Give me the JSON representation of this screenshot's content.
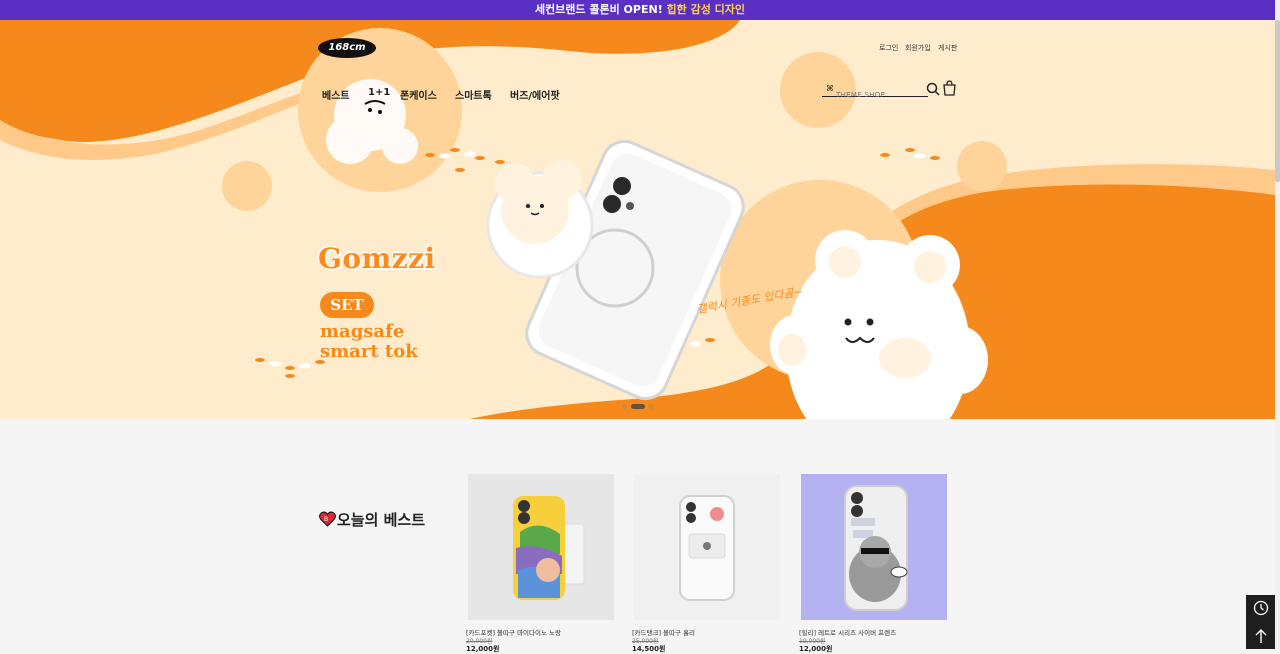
{
  "topbar": {
    "text_a": "세컨브랜드 콜론비 OPEN! ",
    "text_b": "힙한 감성 디자인"
  },
  "header": {
    "logo_text": "168cm",
    "util_links": [
      "로그인",
      "회원가입",
      "게시판"
    ],
    "nav": [
      "베스트",
      "1+1",
      "폰케이스",
      "스마트톡",
      "버즈/에어팟"
    ],
    "search": {
      "placeholder": "THEME SHOP",
      "icon": "search-icon"
    },
    "cart_icon": "bag-icon"
  },
  "hero": {
    "brand": "Gomzzi",
    "pill": "SET",
    "line1": "magsafe",
    "line2": "smart tok",
    "handwriting": "갤럭시 기종도 있다곰~",
    "slides": 3,
    "active_slide": 2,
    "colors": {
      "orange": "#f5891c",
      "cream": "#ffeccd",
      "deep": "#ff8a1c"
    }
  },
  "best": {
    "title": "오늘의 베스트",
    "products": [
      {
        "name": "[카드포켓] 볼따구 마이다이노 노랑",
        "original_price": "20,000원",
        "price": "12,000원",
        "bg": "#e6e6e6"
      },
      {
        "name": "[카드탱크] 볼따구 홀리",
        "original_price": "25,000원",
        "price": "14,500원",
        "bg": "#f0f0f0"
      },
      {
        "name": "[힐리] 레트로 시리즈 사이버 프렌즈",
        "original_price": "19,000원",
        "price": "12,000원",
        "bg": "#b4b2f0"
      }
    ]
  },
  "side": {
    "recent_icon": "clock-icon",
    "top_icon": "arrow-up-icon"
  }
}
